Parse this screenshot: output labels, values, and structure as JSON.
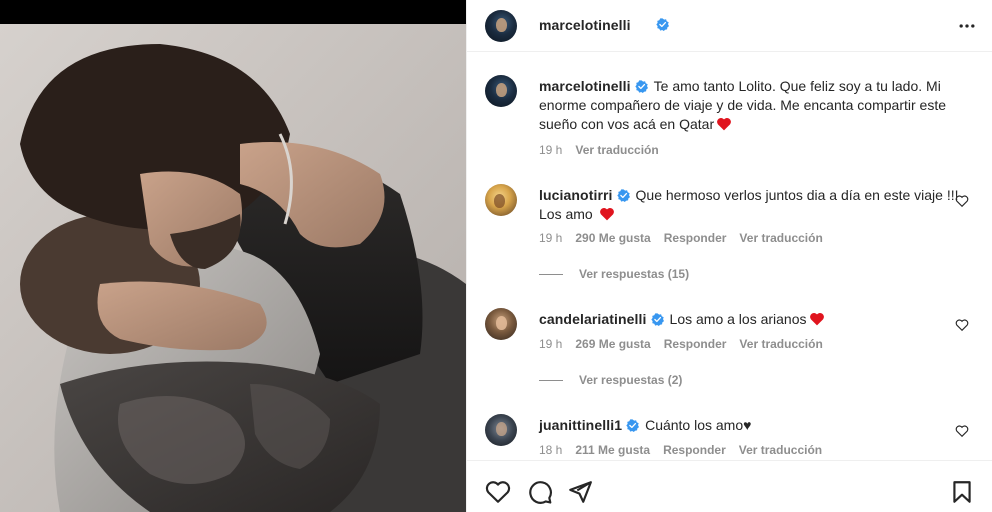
{
  "post": {
    "author": {
      "username": "marcelotinelli",
      "verified": true
    },
    "more_icon": "more-horizontal-icon"
  },
  "caption": {
    "username": "marcelotinelli",
    "text": "Te amo tanto Lolito. Que feliz soy a tu lado. Mi enorme compañero de viaje y de vida. Me encanta compartir este sueño con vos acá en Qatar",
    "emoji": "red-heart",
    "time": "19 h",
    "translate_label": "Ver traducción"
  },
  "comments": [
    {
      "username": "lucianotirri",
      "verified": true,
      "text": "Que hermoso verlos juntos dia a día en este viaje !!! Los amo",
      "emoji": "red-heart",
      "time": "19 h",
      "likes": "290 Me gusta",
      "reply_label": "Responder",
      "translate_label": "Ver traducción",
      "replies_label": "Ver respuestas (15)"
    },
    {
      "username": "candelariatinelli",
      "verified": true,
      "text": "Los amo a los arianos",
      "emoji": "red-heart",
      "time": "19 h",
      "likes": "269 Me gusta",
      "reply_label": "Responder",
      "translate_label": "Ver traducción",
      "replies_label": "Ver respuestas (2)"
    },
    {
      "username": "juanittinelli1",
      "verified": true,
      "text": "Cuánto los amo♥",
      "time": "18 h",
      "likes": "211 Me gusta",
      "reply_label": "Responder",
      "translate_label": "Ver traducción"
    }
  ],
  "actions": {
    "icons": [
      "heart-icon",
      "comment-icon",
      "share-icon",
      "bookmark-icon"
    ]
  },
  "colors": {
    "verified_blue": "#3897f0",
    "heart_red": "#e0141e",
    "meta_gray": "#8e8e8e",
    "text": "#262626"
  }
}
